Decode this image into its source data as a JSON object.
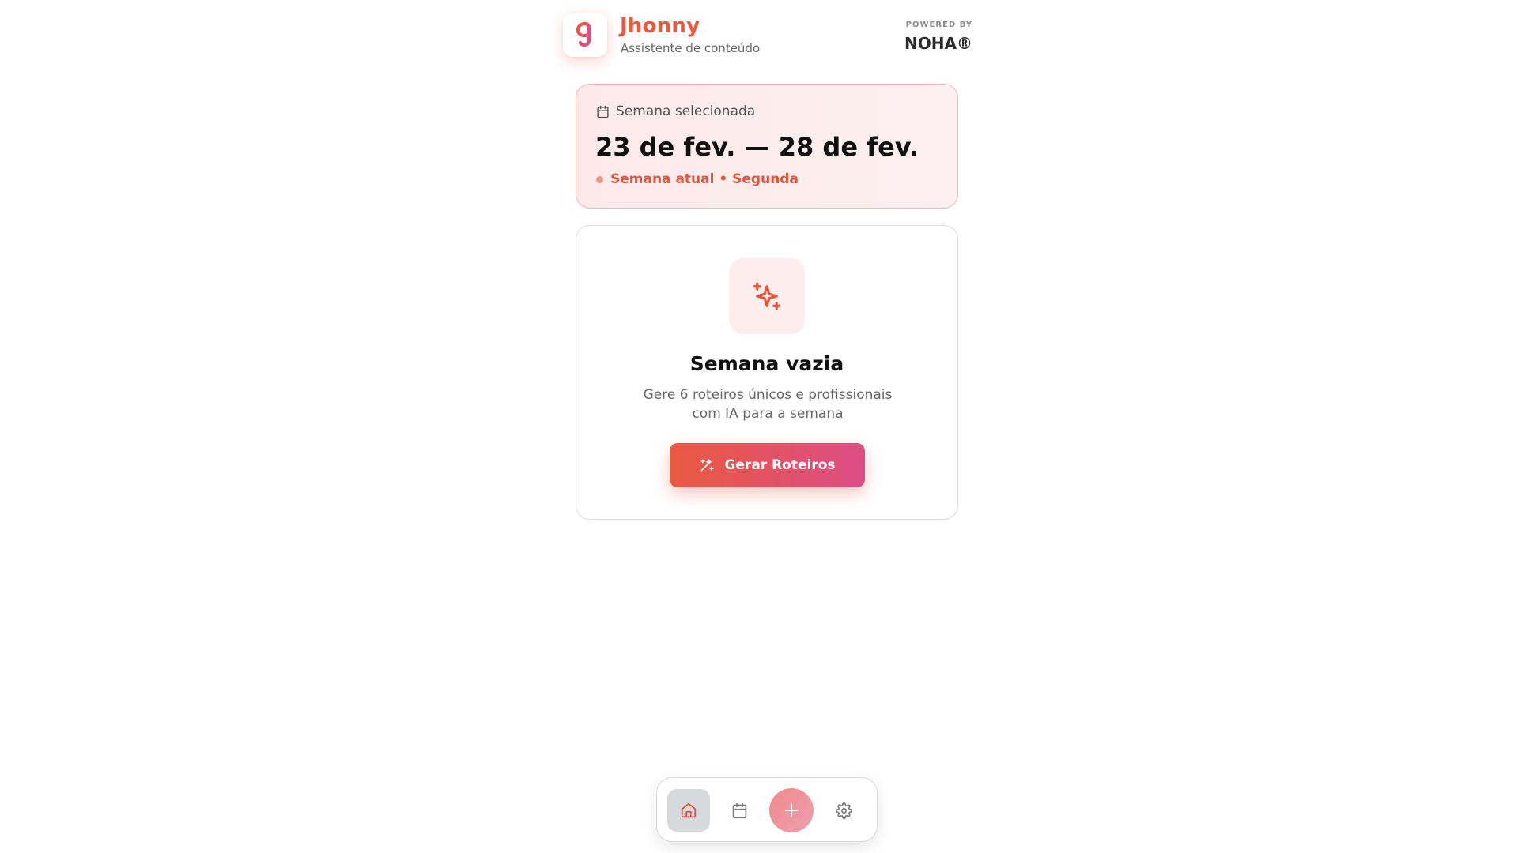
{
  "colors": {
    "accent": "#e85a40",
    "accent_pink": "#de4c86",
    "card_tint": "#fde9e9",
    "text_primary": "#111111",
    "text_muted": "#666666"
  },
  "header": {
    "logo_icon": "app-logo-icon",
    "app_name": "Jhonny",
    "subtitle": "Assistente de conteúdo",
    "powered_by_label": "POWERED BY",
    "powered_by_name": "NOHA®"
  },
  "week_card": {
    "label_icon": "calendar-icon",
    "label": "Semana selecionada",
    "range": "23 de fev. — 28 de fev.",
    "status": "Semana atual • Segunda"
  },
  "empty_state": {
    "icon": "sparkles-icon",
    "title": "Semana vazia",
    "description": "Gere 6 roteiros únicos e profissionais com IA para a semana",
    "button_label": "Gerar Roteiros",
    "button_icon": "wand-sparkles-icon"
  },
  "bottom_nav": {
    "items": [
      {
        "icon": "home-icon",
        "active": true
      },
      {
        "icon": "calendar-icon",
        "active": false
      },
      {
        "icon": "plus-icon",
        "active": false
      },
      {
        "icon": "gear-icon",
        "active": false
      }
    ]
  }
}
